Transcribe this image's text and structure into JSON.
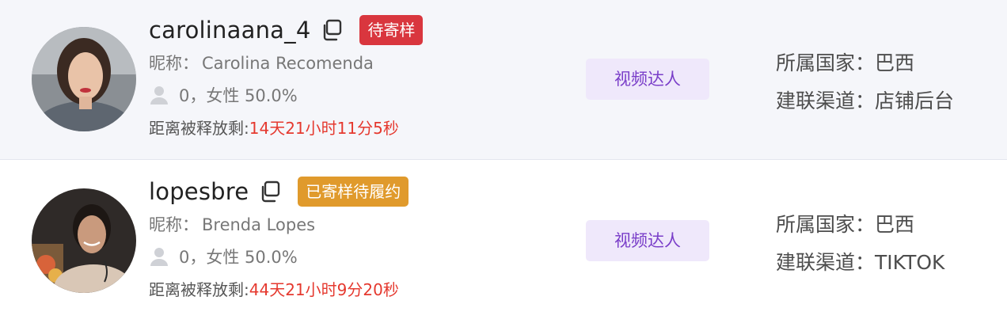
{
  "rows": [
    {
      "username": "carolinaana_4",
      "status": {
        "label": "待寄样",
        "color": "#d9363e"
      },
      "nickname_label": "昵称：",
      "nickname": "Carolina Recomenda",
      "fans_text": "0，女性 50.0%",
      "countdown_label": "距离被释放剩:",
      "countdown_time": "14天21小时11分5秒",
      "type_tag": "视频达人",
      "country_label": "所属国家：",
      "country": "巴西",
      "channel_label": "建联渠道：",
      "channel": "店铺后台"
    },
    {
      "username": "lopesbre",
      "status": {
        "label": "已寄样待履约",
        "color": "#e09a2c"
      },
      "nickname_label": "昵称：",
      "nickname": "Brenda Lopes",
      "fans_text": "0，女性 50.0%",
      "countdown_label": "距离被释放剩:",
      "countdown_time": "44天21小时9分20秒",
      "type_tag": "视频达人",
      "country_label": "所属国家：",
      "country": "巴西",
      "channel_label": "建联渠道：",
      "channel": "TIKTOK"
    }
  ],
  "icons": {
    "copy": "copy-icon",
    "person": "person-icon"
  },
  "colors": {
    "accent_purple": "#7a3ec9",
    "countdown_red": "#e5392f"
  }
}
